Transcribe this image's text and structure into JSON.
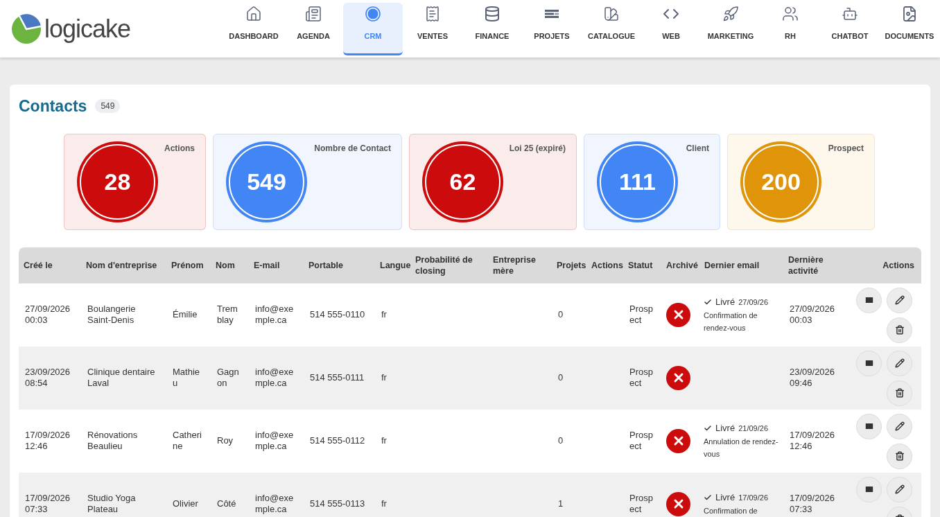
{
  "brand": {
    "name": "logicake"
  },
  "nav": [
    {
      "kind": "home",
      "label": "DASHBOARD",
      "selected": false
    },
    {
      "kind": "news",
      "label": "AGENDA",
      "selected": false
    },
    {
      "kind": "crm",
      "label": "CRM",
      "selected": true
    },
    {
      "kind": "receipt",
      "label": "VENTES",
      "selected": false
    },
    {
      "kind": "coins",
      "label": "FINANCE",
      "selected": false
    },
    {
      "kind": "bars",
      "label": "PROJETS",
      "selected": false
    },
    {
      "kind": "swatch",
      "label": "CATALOGUE",
      "selected": false
    },
    {
      "kind": "code",
      "label": "WEB",
      "selected": false
    },
    {
      "kind": "rocket",
      "label": "MARKETING",
      "selected": false
    },
    {
      "kind": "users",
      "label": "RH",
      "selected": false
    },
    {
      "kind": "bot",
      "label": "CHATBOT",
      "selected": false
    },
    {
      "kind": "file",
      "label": "DOCUMENTS",
      "selected": false
    }
  ],
  "page": {
    "title": "Contacts",
    "count": "549"
  },
  "stats": [
    {
      "label": "Actions",
      "value": "28",
      "color": "#cc0c0c"
    },
    {
      "label": "Nombre de Contact",
      "value": "549",
      "color": "#4285f4"
    },
    {
      "label": "Loi 25 (expiré)",
      "value": "62",
      "color": "#cc0c0c"
    },
    {
      "label": "Client",
      "value": "111",
      "color": "#4285f4"
    },
    {
      "label": "Prospect",
      "value": "200",
      "color": "#e0940a"
    }
  ],
  "table": {
    "columns": [
      "Créé le",
      "Nom d'entreprise",
      "Prénom",
      "Nom",
      "E-mail",
      "Portable",
      "Langue",
      "Probabilité de closing",
      "Entreprise mère",
      "Projets",
      "Actions",
      "Statut",
      "Archivé",
      "Dernier email",
      "Dernière activité",
      "Actions"
    ],
    "rows": [
      {
        "created": "27/09/2026 00:03",
        "company": "Boulangerie Saint-Denis",
        "first_name": "Émilie",
        "last_name": "Tremblay",
        "email": "info@exemple.ca",
        "mobile": "514 555-0110",
        "language": "fr",
        "projects": "0",
        "status": "Prospect",
        "archived": false,
        "last_email": {
          "status": "Livré",
          "date": "27/09/26",
          "subject": "Confirmation de rendez-vous"
        },
        "last_activity": "27/09/2026 00:03"
      },
      {
        "created": "23/09/2026 08:54",
        "company": "Clinique dentaire Laval",
        "first_name": "Mathieu",
        "last_name": "Gagnon",
        "email": "info@exemple.ca",
        "mobile": "514 555-0111",
        "language": "fr",
        "projects": "0",
        "status": "Prospect",
        "archived": false,
        "last_activity": "23/09/2026 09:46"
      },
      {
        "created": "17/09/2026 12:46",
        "company": "Rénovations Beaulieu",
        "first_name": "Catherine",
        "last_name": "Roy",
        "email": "info@exemple.ca",
        "mobile": "514 555-0112",
        "language": "fr",
        "projects": "0",
        "status": "Prospect",
        "archived": false,
        "last_email": {
          "status": "Livré",
          "date": "21/09/26",
          "subject": "Annulation de rendez-vous"
        },
        "last_activity": "17/09/2026 12:46"
      },
      {
        "created": "17/09/2026 07:33",
        "company": "Studio Yoga Plateau",
        "first_name": "Olivier",
        "last_name": "Côté",
        "email": "info@exemple.ca",
        "mobile": "514 555-0113",
        "language": "fr",
        "projects": "1",
        "status": "Prospect",
        "archived": false,
        "last_email": {
          "status": "Livré",
          "date": "17/09/26",
          "subject": "Confirmation de"
        },
        "last_activity": "17/09/2026 07:33"
      }
    ]
  }
}
